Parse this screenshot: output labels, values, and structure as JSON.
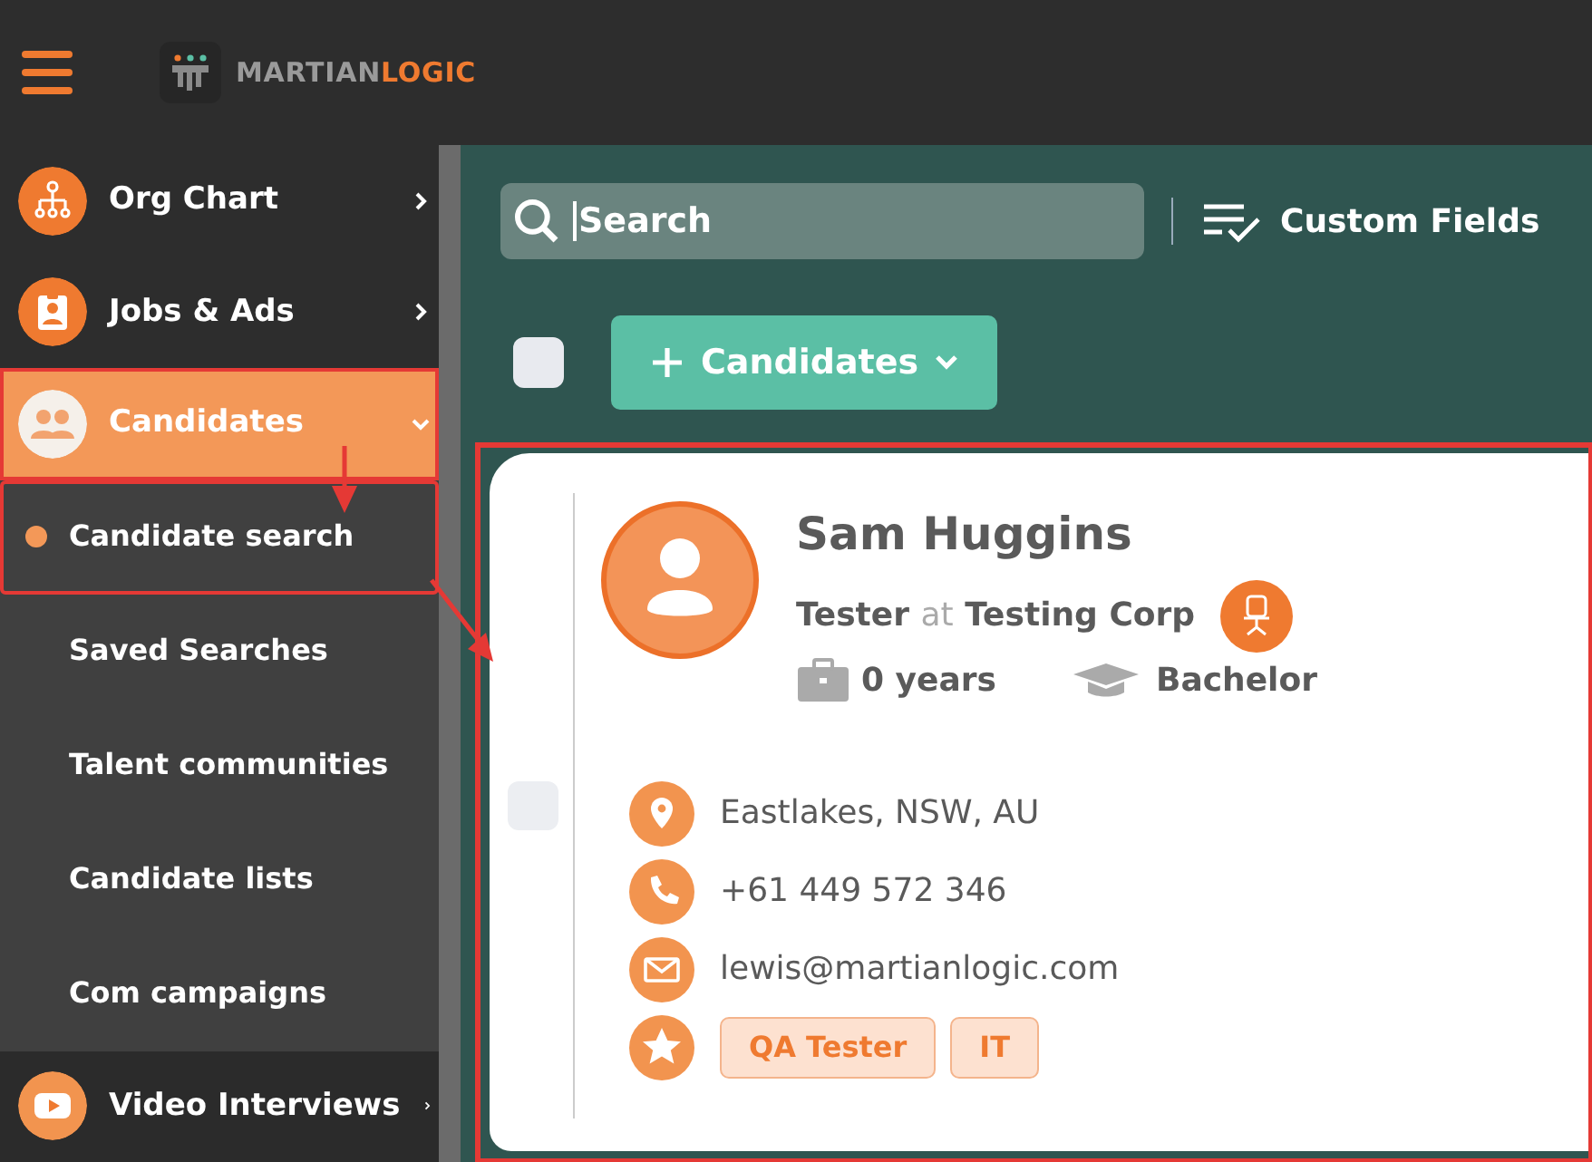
{
  "header": {
    "brand_a": "MARTIAN",
    "brand_b": "LOGIC"
  },
  "sidebar": {
    "items": [
      {
        "label": "Org Chart",
        "selected": false,
        "expanded": false
      },
      {
        "label": "Jobs & Ads",
        "selected": false,
        "expanded": false
      },
      {
        "label": "Candidates",
        "selected": true,
        "expanded": true,
        "children": [
          {
            "label": "Candidate search",
            "selected": true
          },
          {
            "label": "Saved Searches",
            "selected": false
          },
          {
            "label": "Talent communities",
            "selected": false
          },
          {
            "label": "Candidate lists",
            "selected": false
          },
          {
            "label": "Com campaigns",
            "selected": false
          }
        ]
      },
      {
        "label": "Video Interviews",
        "selected": false,
        "expanded": false
      }
    ]
  },
  "toolbar": {
    "search": {
      "value": "Search"
    },
    "custom_fields": "Custom Fields",
    "select_all_checked": false,
    "add_button": "Candidates"
  },
  "candidate": {
    "checked": false,
    "name": "Sam Huggins",
    "title": "Tester",
    "at": "at",
    "company": "Testing Corp",
    "experience": "0 years",
    "education": "Bachelor",
    "contacts": [
      {
        "kind": "location",
        "text": "Eastlakes, NSW, AU"
      },
      {
        "kind": "phone",
        "text": "+61 449 572 346"
      },
      {
        "kind": "email",
        "text": "lewis@martianlogic.com"
      }
    ],
    "tags": [
      "QA Tester",
      "IT"
    ]
  }
}
